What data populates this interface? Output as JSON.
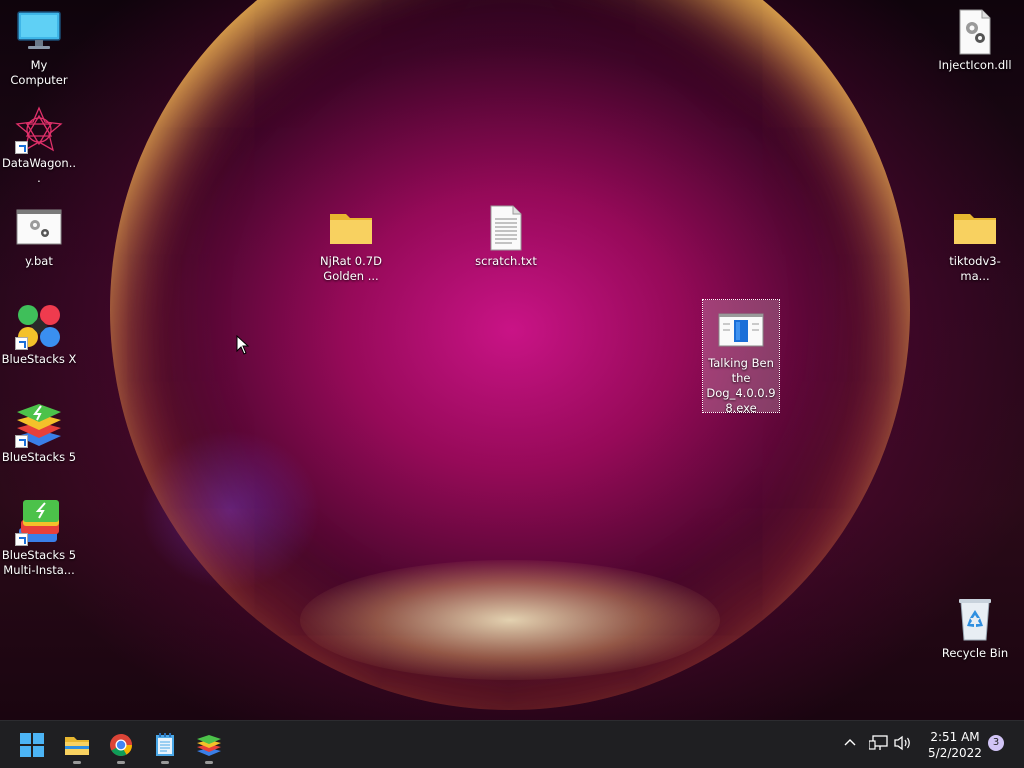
{
  "desktop": {
    "icons": [
      {
        "id": "my-computer",
        "label": "My Computer"
      },
      {
        "id": "datawagon",
        "label": "DataWagon..."
      },
      {
        "id": "ybat",
        "label": "y.bat"
      },
      {
        "id": "bluestacks-x",
        "label": "BlueStacks X"
      },
      {
        "id": "bluestacks-5",
        "label": "BlueStacks 5"
      },
      {
        "id": "bluestacks-5-multi",
        "label": "BlueStacks 5 Multi-Insta..."
      },
      {
        "id": "njrat",
        "label": "NjRat 0.7D Golden ..."
      },
      {
        "id": "scratch",
        "label": "scratch.txt"
      },
      {
        "id": "talking-ben",
        "label": "Talking Ben the Dog_4.0.0.98.exe"
      },
      {
        "id": "injecticon",
        "label": "InjectIcon.dll"
      },
      {
        "id": "tiktod",
        "label": "tiktodv3-ma..."
      },
      {
        "id": "recycle-bin",
        "label": "Recycle Bin"
      }
    ]
  },
  "taskbar": {
    "clock_time": "2:51 AM",
    "clock_date": "5/2/2022",
    "notification_count": "3"
  }
}
